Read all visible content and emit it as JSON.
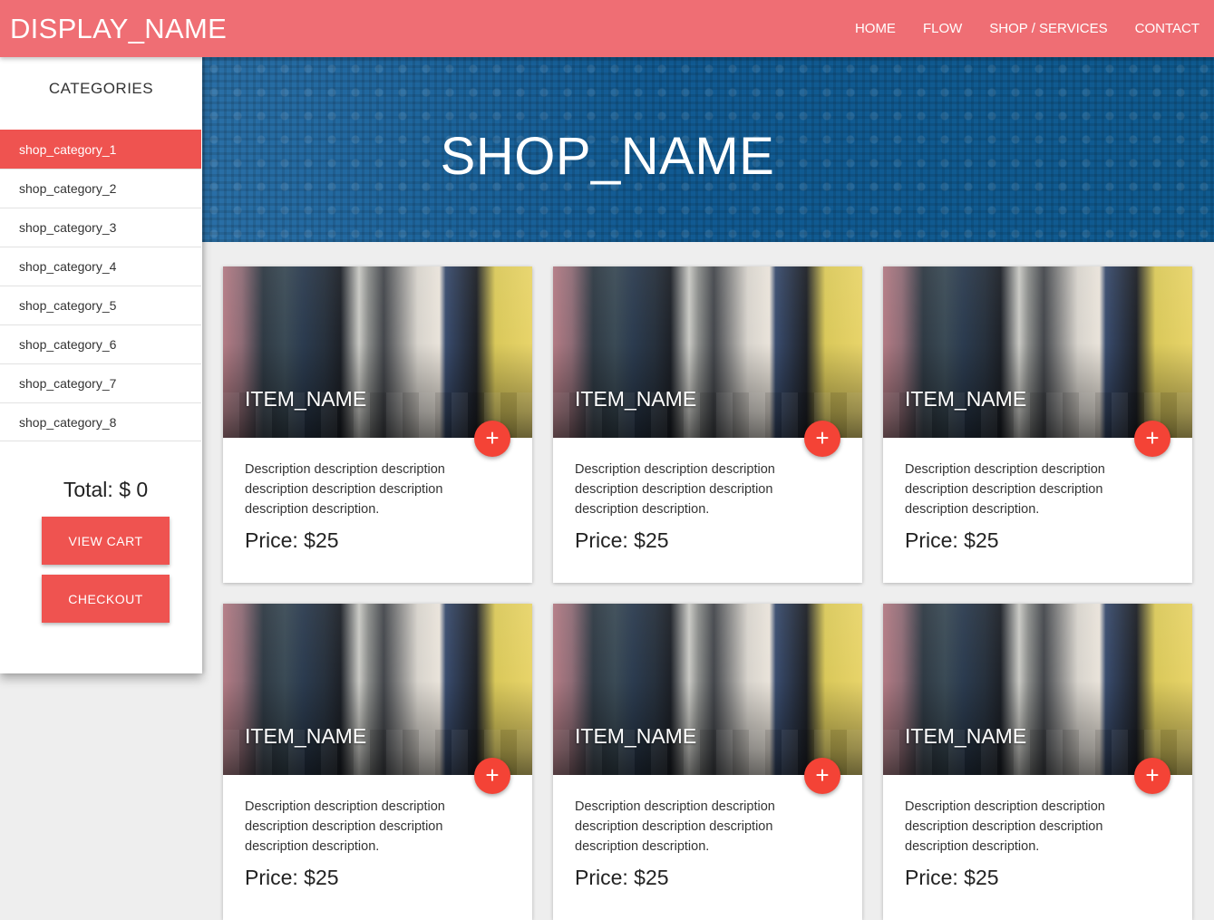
{
  "header": {
    "brand": "DISPLAY_NAME",
    "nav": [
      "HOME",
      "FLOW",
      "SHOP / SERVICES",
      "CONTACT"
    ]
  },
  "sidebar": {
    "title": "CATEGORIES",
    "categories": [
      "shop_category_1",
      "shop_category_2",
      "shop_category_3",
      "shop_category_4",
      "shop_category_5",
      "shop_category_6",
      "shop_category_7",
      "shop_category_8"
    ],
    "active_index": 0,
    "total_label": "Total: $ 0",
    "view_cart_label": "VIEW CART",
    "checkout_label": "CHECKOUT"
  },
  "banner": {
    "title": "SHOP_NAME"
  },
  "products": [
    {
      "name": "ITEM_NAME",
      "description": "Description description description description description description description description.",
      "price": "Price: $25",
      "add_icon": "+"
    },
    {
      "name": "ITEM_NAME",
      "description": "Description description description description description description description description.",
      "price": "Price: $25",
      "add_icon": "+"
    },
    {
      "name": "ITEM_NAME",
      "description": "Description description description description description description description description.",
      "price": "Price: $25",
      "add_icon": "+"
    },
    {
      "name": "ITEM_NAME",
      "description": "Description description description description description description description description.",
      "price": "Price: $25",
      "add_icon": "+"
    },
    {
      "name": "ITEM_NAME",
      "description": "Description description description description description description description description.",
      "price": "Price: $25",
      "add_icon": "+"
    },
    {
      "name": "ITEM_NAME",
      "description": "Description description description description description description description description.",
      "price": "Price: $25",
      "add_icon": "+"
    }
  ],
  "colors": {
    "app_bar": "#ef6e74",
    "accent": "#ef5350",
    "fab": "#f44336",
    "banner": "#14629a",
    "background": "#eeeeee"
  }
}
